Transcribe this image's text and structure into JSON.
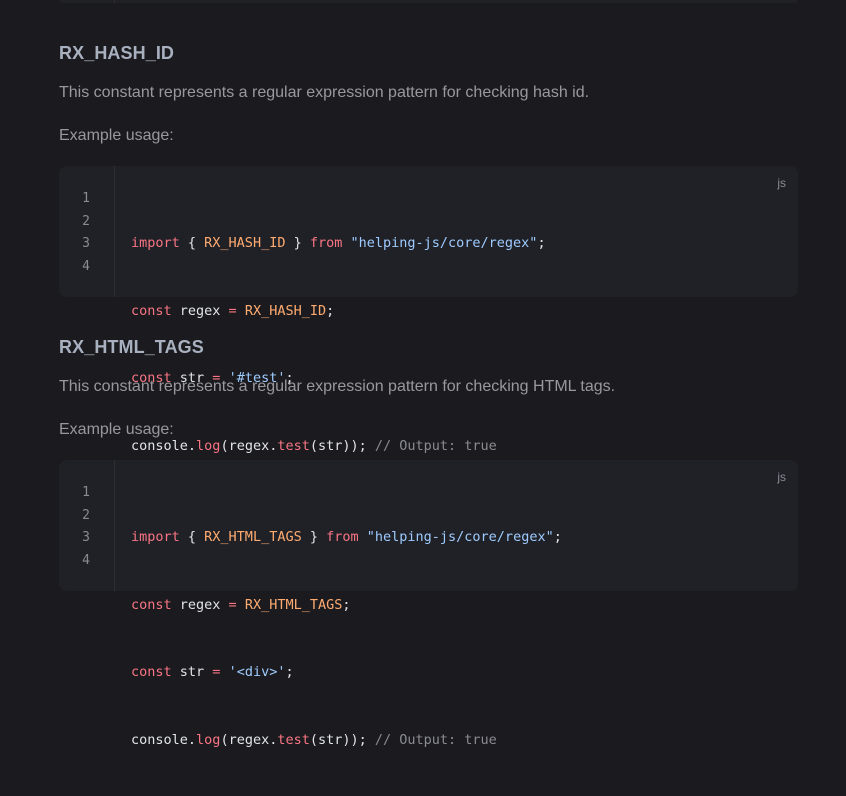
{
  "sections": [
    {
      "heading": "RX_HASH_ID",
      "description": "This constant represents a regular expression pattern for checking hash id.",
      "example_label": "Example usage:",
      "code": {
        "lang": "js",
        "line_numbers": [
          "1",
          "2",
          "3",
          "4"
        ],
        "lines": [
          {
            "t1": "import",
            "t2": " { ",
            "t3": "RX_HASH_ID",
            "t4": " } ",
            "t5": "from",
            "t6": " ",
            "t7": "\"helping-js/core/regex\"",
            "t8": ";"
          },
          {
            "t1": "const",
            "t2": " regex ",
            "t3": "=",
            "t4": " ",
            "t5": "RX_HASH_ID",
            "t6": ";"
          },
          {
            "t1": "const",
            "t2": " str ",
            "t3": "=",
            "t4": " ",
            "t5": "'#test'",
            "t6": ";"
          },
          {
            "t1": "console",
            "t2": ".",
            "t3": "log",
            "t4": "(regex.",
            "t5": "test",
            "t6": "(str)); ",
            "t7": "// Output: true"
          }
        ]
      }
    },
    {
      "heading": "RX_HTML_TAGS",
      "description": "This constant represents a regular expression pattern for checking HTML tags.",
      "example_label": "Example usage:",
      "code": {
        "lang": "js",
        "line_numbers": [
          "1",
          "2",
          "3",
          "4"
        ],
        "lines": [
          {
            "t1": "import",
            "t2": " { ",
            "t3": "RX_HTML_TAGS",
            "t4": " } ",
            "t5": "from",
            "t6": " ",
            "t7": "\"helping-js/core/regex\"",
            "t8": ";"
          },
          {
            "t1": "const",
            "t2": " regex ",
            "t3": "=",
            "t4": " ",
            "t5": "RX_HTML_TAGS",
            "t6": ";"
          },
          {
            "t1": "const",
            "t2": " str ",
            "t3": "=",
            "t4": " ",
            "t5": "'<div>'",
            "t6": ";"
          },
          {
            "t1": "console",
            "t2": ".",
            "t3": "log",
            "t4": "(regex.",
            "t5": "test",
            "t6": "(str)); ",
            "t7": "// Output: true"
          }
        ]
      }
    }
  ]
}
